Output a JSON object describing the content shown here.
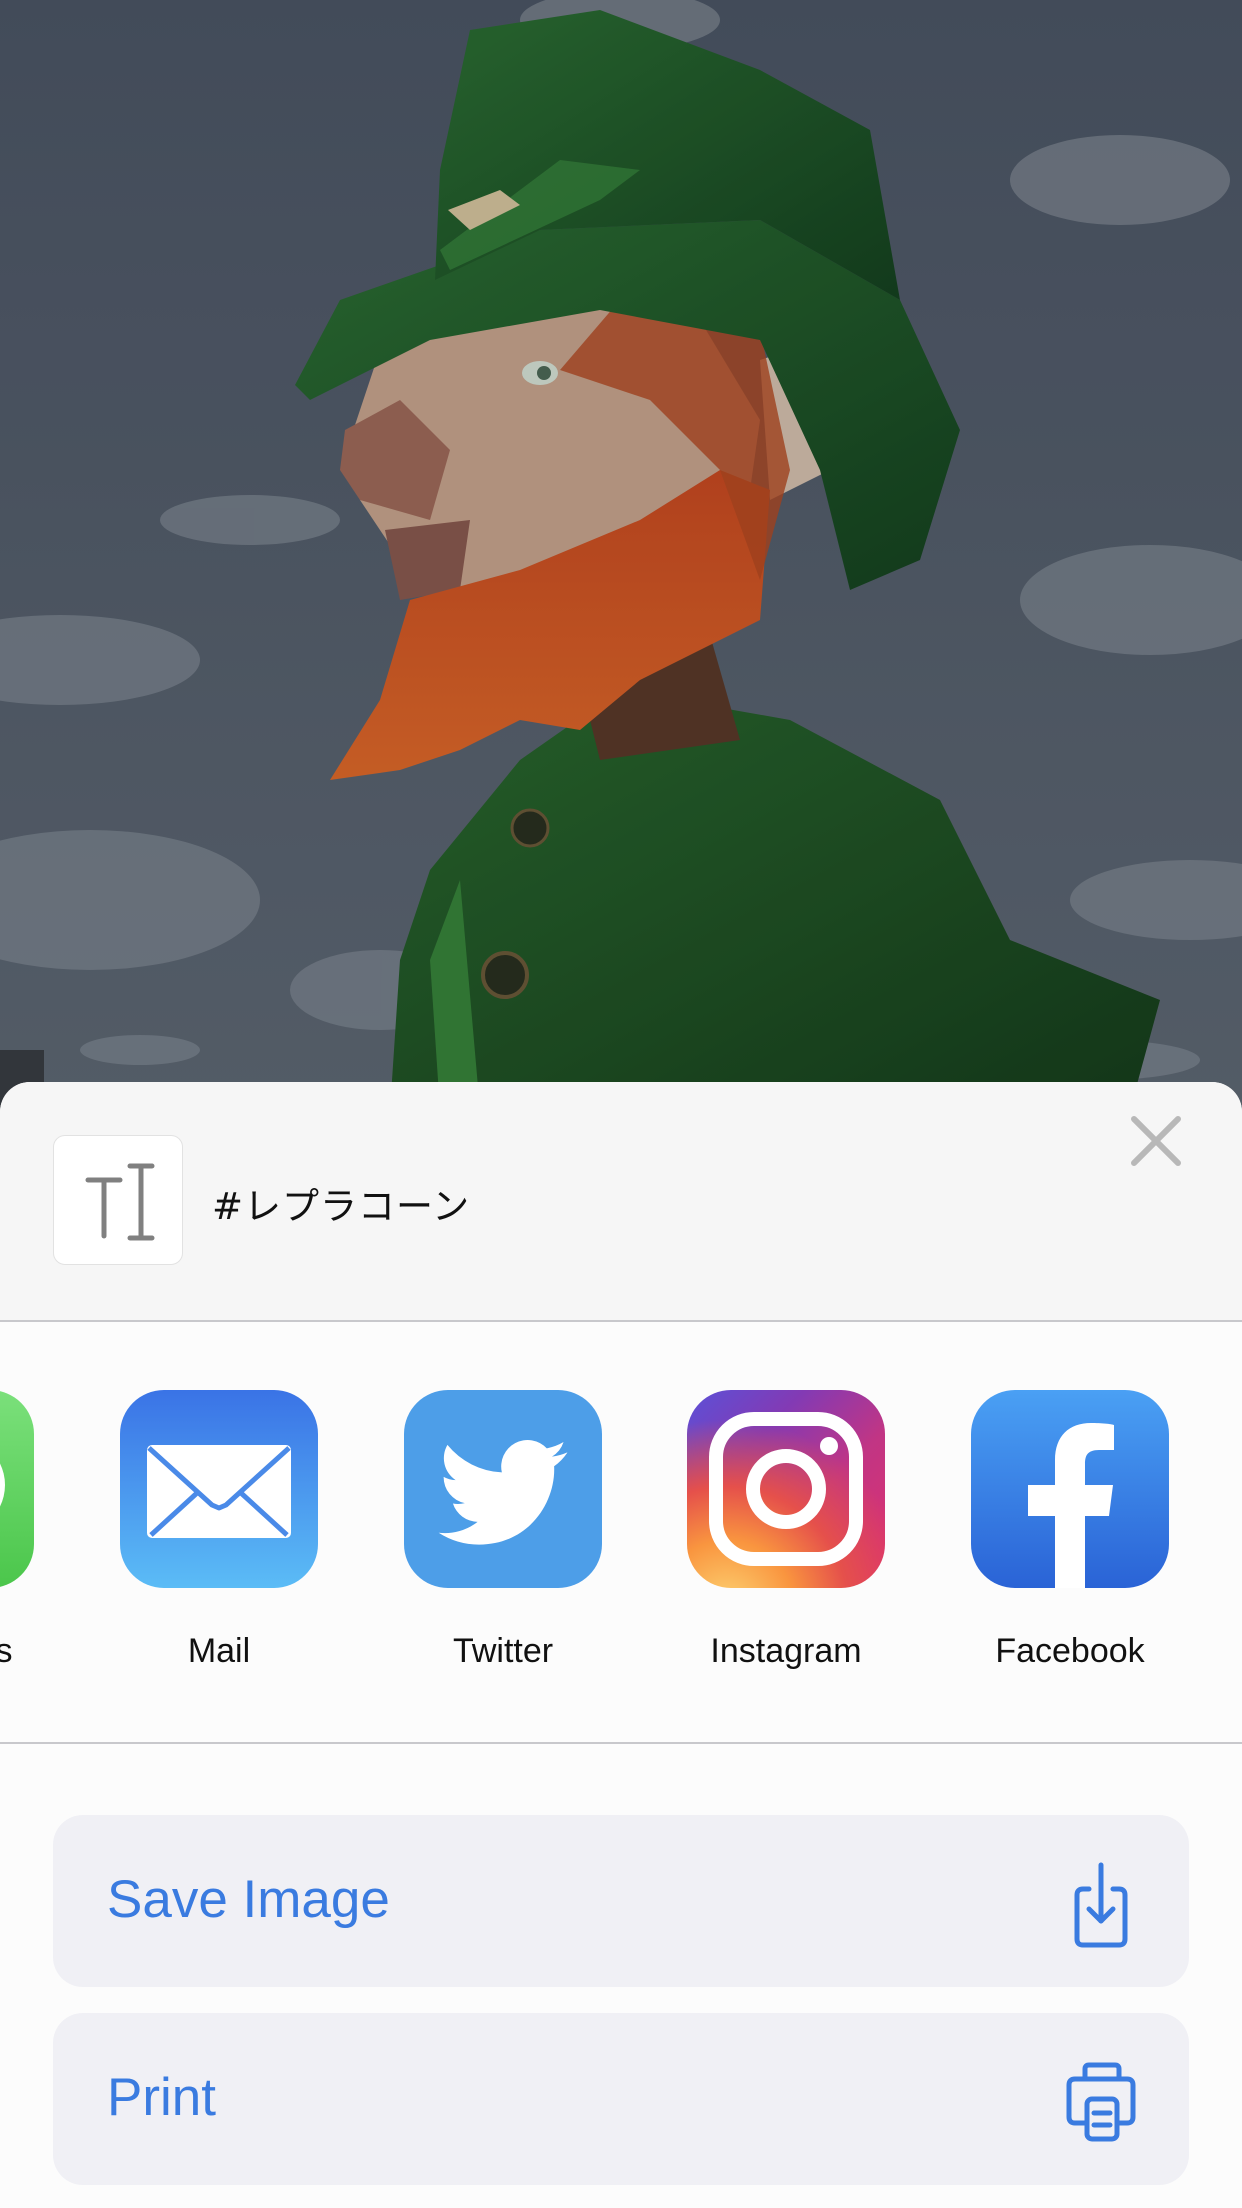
{
  "background": {
    "description": "3D leprechaun character with green hat and coat, orange beard, against cloudy sky",
    "colors": {
      "sky": "#56616f",
      "cloud": "#8a929c",
      "hat": "#1f5a2a",
      "coat": "#1d4d24",
      "beard": "#d4542a",
      "skin": "#c9a58f"
    }
  },
  "share_sheet": {
    "preview": {
      "icon": "text-document-icon",
      "text": "#レプラコーン"
    },
    "close_icon": "close-icon",
    "apps": [
      {
        "label": "Messages",
        "icon": "messages-icon",
        "color": "#4bc64b"
      },
      {
        "label": "Mail",
        "icon": "mail-icon",
        "color": "#3a73e6"
      },
      {
        "label": "Twitter",
        "icon": "twitter-icon",
        "color": "#4d9ee8"
      },
      {
        "label": "Instagram",
        "icon": "instagram-icon",
        "color": "#c13584"
      },
      {
        "label": "Facebook",
        "icon": "facebook-icon",
        "color": "#2a63d6"
      }
    ],
    "actions": [
      {
        "label": "Save Image",
        "icon": "save-image-icon"
      },
      {
        "label": "Print",
        "icon": "printer-icon"
      }
    ],
    "accent_color": "#3a7be0"
  }
}
